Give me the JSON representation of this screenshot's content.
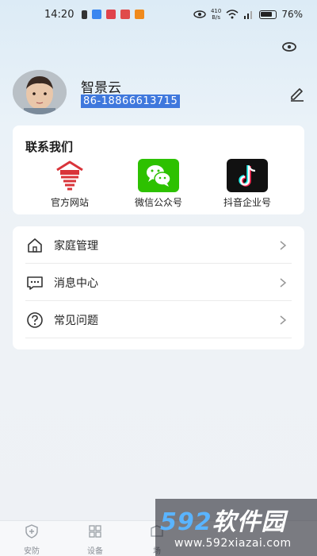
{
  "status_bar": {
    "time": "14:20",
    "net_speed_value": "410",
    "net_speed_unit": "B/s",
    "battery": "76%"
  },
  "profile": {
    "name": "智景云",
    "phone": "86-18866613715"
  },
  "contact": {
    "title": "联系我们",
    "items": [
      {
        "label": "官方网站",
        "icon": "official-site-icon",
        "color": "#d9343a"
      },
      {
        "label": "微信公众号",
        "icon": "wechat-icon",
        "color": "#2dc100"
      },
      {
        "label": "抖音企业号",
        "icon": "douyin-icon",
        "color": "#111111"
      }
    ]
  },
  "menu": {
    "items": [
      {
        "label": "家庭管理",
        "icon": "home-icon"
      },
      {
        "label": "消息中心",
        "icon": "message-icon"
      },
      {
        "label": "常见问题",
        "icon": "help-icon"
      }
    ]
  },
  "tabbar": {
    "tabs": [
      {
        "label": "安防",
        "icon": "shield-icon"
      },
      {
        "label": "设备",
        "icon": "grid-icon"
      },
      {
        "label": "场",
        "icon": "scene-icon"
      }
    ]
  },
  "watermark": {
    "title_a": "592",
    "title_b": "软件园",
    "url": "www.592xiazai.com"
  },
  "colors": {
    "accent": "#3f78dd",
    "card": "#ffffff",
    "text": "#222222"
  }
}
